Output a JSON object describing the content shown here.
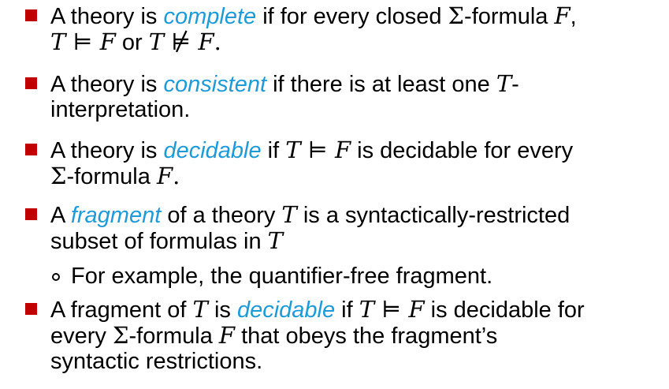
{
  "items": [
    {
      "l1": {
        "a": "A theory is ",
        "hl": "complete",
        "b": " if for every closed ",
        "sigma": "Σ",
        "c": "-formula ",
        "F": "F",
        "d": ","
      },
      "l2": {
        "T1": "T",
        "ent": " ⊨ ",
        "F1": "F",
        "or": " or ",
        "T2": "T",
        "nent": " ⊭ ",
        "F2": "F",
        "end": "."
      }
    },
    {
      "l1": {
        "a": "A theory is ",
        "hl": "consistent",
        "b": " if there is at least one ",
        "T": "T",
        "c": "-"
      },
      "l2": {
        "a": "interpretation."
      }
    },
    {
      "l1": {
        "a": "A theory is ",
        "hl": "decidable",
        "b": " if ",
        "T": "T",
        "ent": " ⊨ ",
        "F": "F",
        "c": " is decidable for every"
      },
      "l2": {
        "sigma": "Σ",
        "a": "-formula ",
        "F": "F",
        "end": "."
      }
    },
    {
      "l1": {
        "a": "A ",
        "hl": "fragment",
        "b": " of a theory ",
        "T": "T",
        "c": " is a syntactically-restricted"
      },
      "l2": {
        "a": "subset of formulas in ",
        "T": "T"
      }
    },
    {
      "l1": {
        "a": "A fragment of ",
        "T": "T",
        "b": " is ",
        "hl": "decidable",
        "c": " if ",
        "T2": "T",
        "ent": " ⊨ ",
        "F": "F",
        "d": " is decidable for"
      },
      "l2": {
        "a": "every ",
        "sigma": "Σ",
        "b": "-formula ",
        "F": "F",
        "c": " that obeys the fragment’s"
      },
      "l3": {
        "a": "syntactic restrictions."
      }
    }
  ],
  "sub_item": "For example, the quantifier-free fragment.",
  "colors": {
    "bullet": "#C00000",
    "highlight": "#1E9BD7"
  }
}
